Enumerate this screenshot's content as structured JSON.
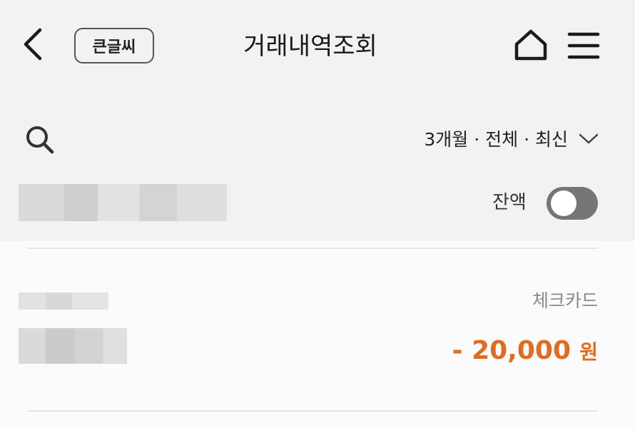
{
  "header": {
    "title": "거래내역조회",
    "big_font_label": "큰글씨",
    "back_icon": "chevron-left-icon",
    "home_icon": "home-icon",
    "menu_icon": "hamburger-menu-icon"
  },
  "filter": {
    "search_icon": "search-icon",
    "summary": "3개월 · 전체 · 최신",
    "dropdown_icon": "chevron-down-icon"
  },
  "account": {
    "balance_label": "잔액",
    "balance_toggle_on": false
  },
  "transactions": [
    {
      "type": "체크카드",
      "amount": "- 20,000",
      "currency": "원"
    }
  ],
  "colors": {
    "amount_withdrawal": "#e06c20",
    "toggle_off": "#757575",
    "background_top": "#f2f2f3",
    "background_list": "#fbfbfb"
  }
}
